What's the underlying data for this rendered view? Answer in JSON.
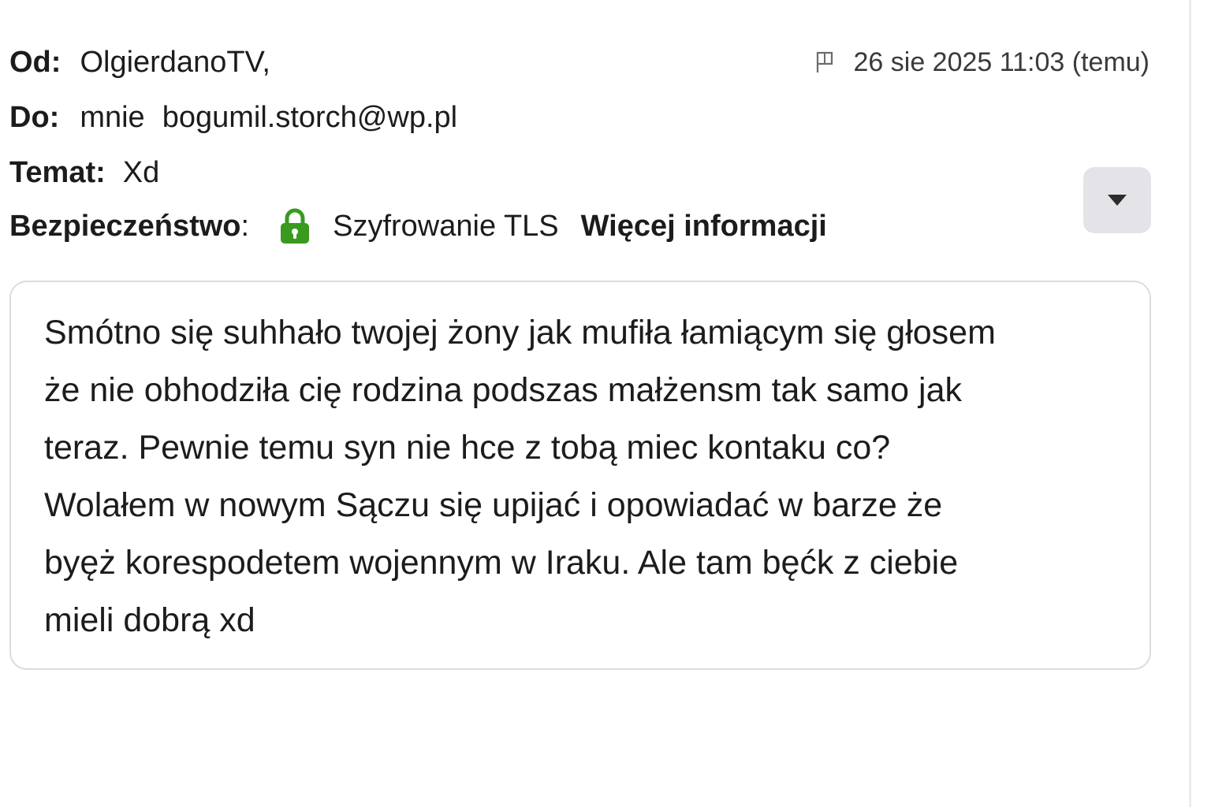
{
  "header": {
    "from_label": "Od:",
    "from_value": "OlgierdanoTV,",
    "to_label": "Do:",
    "to_me": "mnie",
    "to_email": "bogumil.storch@wp.pl",
    "subject_label": "Temat:",
    "subject_value": "Xd",
    "security_label": "Bezpieczeństwo",
    "security_colon": ":",
    "security_value": "Szyfrowanie TLS",
    "more_info": "Więcej informacji",
    "date": "26 sie 2025 11:03 (temu)"
  },
  "icons": {
    "flag": "flag-icon",
    "lock": "lock-icon",
    "expand": "chevron-down-icon"
  },
  "colors": {
    "lock": "#3a9a1e",
    "expand_bg": "#e4e4e8",
    "border": "#dcdce0"
  },
  "message": {
    "body": "Smótno się suhhało twojej żony jak mufiła łamiącym się głosem\nże nie obhodziła cię rodzina podszas małżensm tak samo jak\nteraz. Pewnie temu syn nie hce z tobą miec kontaku co?\nWolałem w nowym Sączu się upijać i opowiadać w barze że\nbyęż korespodetem wojennym w Iraku. Ale tam bęćk z ciebie\nmieli dobrą xd"
  }
}
